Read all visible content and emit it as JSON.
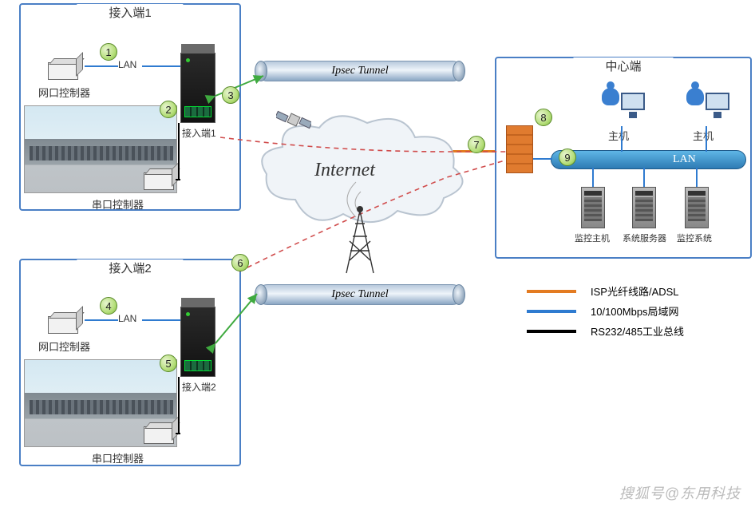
{
  "access1": {
    "title": "接入端1",
    "net_controller_label": "网口控制器",
    "serial_controller_label": "串口控制器",
    "device_label": "接入端1",
    "lan_tag": "LAN"
  },
  "access2": {
    "title": "接入端2",
    "net_controller_label": "网口控制器",
    "serial_controller_label": "串口控制器",
    "device_label": "接入端2",
    "lan_tag": "LAN"
  },
  "center": {
    "title": "中心端",
    "host1_label": "主机",
    "host2_label": "主机",
    "server1_label": "监控主机",
    "server2_label": "系统服务器",
    "server3_label": "监控系统",
    "lan_label": "LAN"
  },
  "tunnel1_label": "Ipsec Tunnel",
  "tunnel2_label": "Ipsec Tunnel",
  "internet_label": "Internet",
  "legend": {
    "isp": "ISP光纤线路/ADSL",
    "lan": "10/100Mbps局域网",
    "serial": "RS232/485工业总线"
  },
  "badges": {
    "b1": "1",
    "b2": "2",
    "b3": "3",
    "b4": "4",
    "b5": "5",
    "b6": "6",
    "b7": "7",
    "b8": "8",
    "b9": "9"
  },
  "watermark": "搜狐号@东用科技"
}
